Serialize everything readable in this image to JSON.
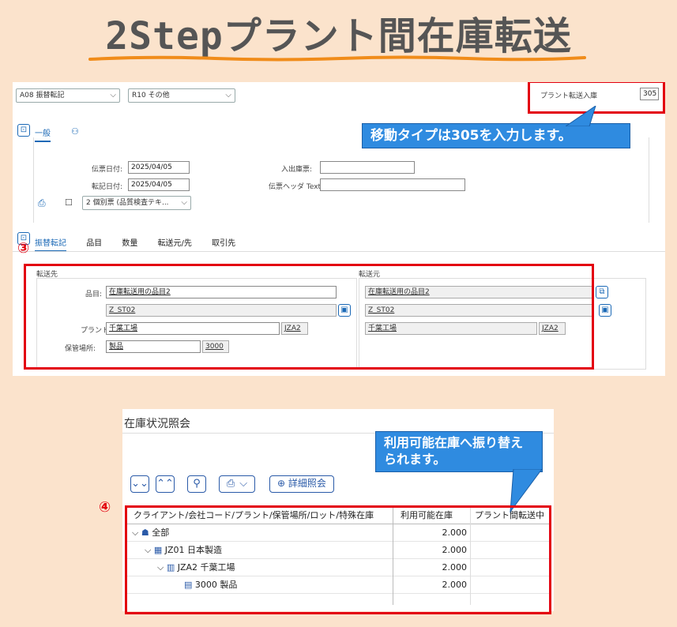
{
  "title": "2Stepプラント間在庫転送",
  "top": {
    "movement_select": "A08 振替転記",
    "reference_select": "R10 その他",
    "movement_type_label": "プラント転送入庫",
    "movement_type_value": "305",
    "header_tabs": [
      "一般"
    ],
    "fields": {
      "doc_date_label": "伝票日付:",
      "doc_date": "2025/04/05",
      "post_date_label": "転記日付:",
      "post_date": "2025/04/05",
      "delivery_label": "入出庫票:",
      "header_text_label": "伝票ヘッダ Text:",
      "print_select": "2 個別票 (品質検査テキ..."
    },
    "bubble": "移動タイプは305を入力します。",
    "step_marker": "③",
    "item_tabs": [
      "振替転記",
      "品目",
      "数量",
      "転送元/先",
      "取引先"
    ],
    "dest": {
      "heading": "転送先",
      "material_label": "品目:",
      "material": "在庫転送用の品目2",
      "material_code": "Z_ST02",
      "plant_label": "プラント:",
      "plant": "千葉工場",
      "plant_code": "JZA2",
      "sloc_label": "保管場所:",
      "sloc": "製品",
      "sloc_code": "3000"
    },
    "source": {
      "heading": "転送元",
      "material": "在庫転送用の品目2",
      "material_code": "Z_ST02",
      "plant": "千葉工場",
      "plant_code": "JZA2"
    }
  },
  "bottom": {
    "panel_title": "在庫状況照会",
    "bubble": "利用可能在庫へ振り替えられます。",
    "step_marker": "④",
    "detail_button": "詳細照会",
    "columns": [
      "クライアント/会社コード/プラント/保管場所/ロット/特殊在庫",
      "利用可能在庫",
      "プラント間転送中"
    ],
    "rows": [
      {
        "label": "全部",
        "value": "2.000",
        "icon": "globe-icon"
      },
      {
        "label": "JZ01 日本製造",
        "value": "2.000",
        "icon": "company-icon"
      },
      {
        "label": "JZA2 千葉工場",
        "value": "2.000",
        "icon": "plant-icon"
      },
      {
        "label": "3000 製品",
        "value": "2.000",
        "icon": "storage-icon"
      }
    ]
  },
  "colors": {
    "background": "#fbe3cc",
    "highlight": "#e3000f",
    "bubble": "#2f8be0",
    "sap_blue": "#1b69b6"
  }
}
